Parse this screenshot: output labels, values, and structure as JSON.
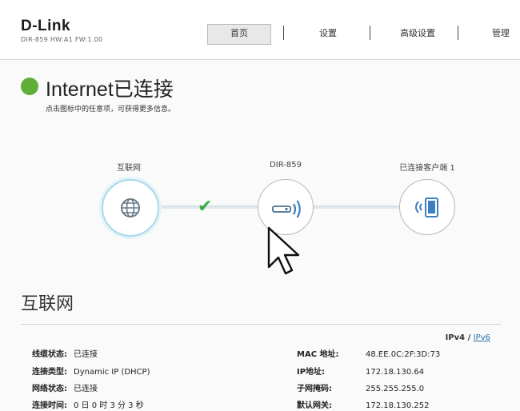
{
  "header": {
    "brand": "D-Link",
    "model_line": "DIR-859   HW:A1   FW:1.00",
    "nav": {
      "home": "首页",
      "settings": "设置",
      "advanced": "高级设置",
      "manage": "管理"
    }
  },
  "status": {
    "title": "Internet已连接",
    "subtitle": "点击图标中的任意项，可获得更多信息。",
    "dot_color": "#5fae3a"
  },
  "topology": {
    "internet_label": "互联网",
    "router_label": "DIR-859",
    "clients_label": "已连接客户端  1",
    "internet_icon": "globe-icon",
    "router_icon": "router-wifi-icon",
    "clients_icon": "tablet-wifi-icon",
    "link_status_icon": "check-icon",
    "check_glyph": "✔",
    "accent_color": "#3aa94a"
  },
  "internet_section": {
    "title": "互联网",
    "ip_versions": {
      "v4": "IPv4",
      "sep": "/",
      "v6": "IPv6"
    },
    "left": [
      {
        "key": "线缆状态:",
        "value": "已连接"
      },
      {
        "key": "连接类型:",
        "value": "Dynamic IP (DHCP)"
      },
      {
        "key": "网络状态:",
        "value": "已连接"
      },
      {
        "key": "连接时间:",
        "value": "0 日 0 时 3 分 3 秒"
      }
    ],
    "right": [
      {
        "key": "MAC 地址:",
        "value": "48.EE.0C:2F:3D:73"
      },
      {
        "key": "IP地址:",
        "value": "172.18.130.64"
      },
      {
        "key": "子网掩码:",
        "value": "255.255.255.0"
      },
      {
        "key": "默认网关:",
        "value": "172.18.130.252"
      }
    ]
  }
}
